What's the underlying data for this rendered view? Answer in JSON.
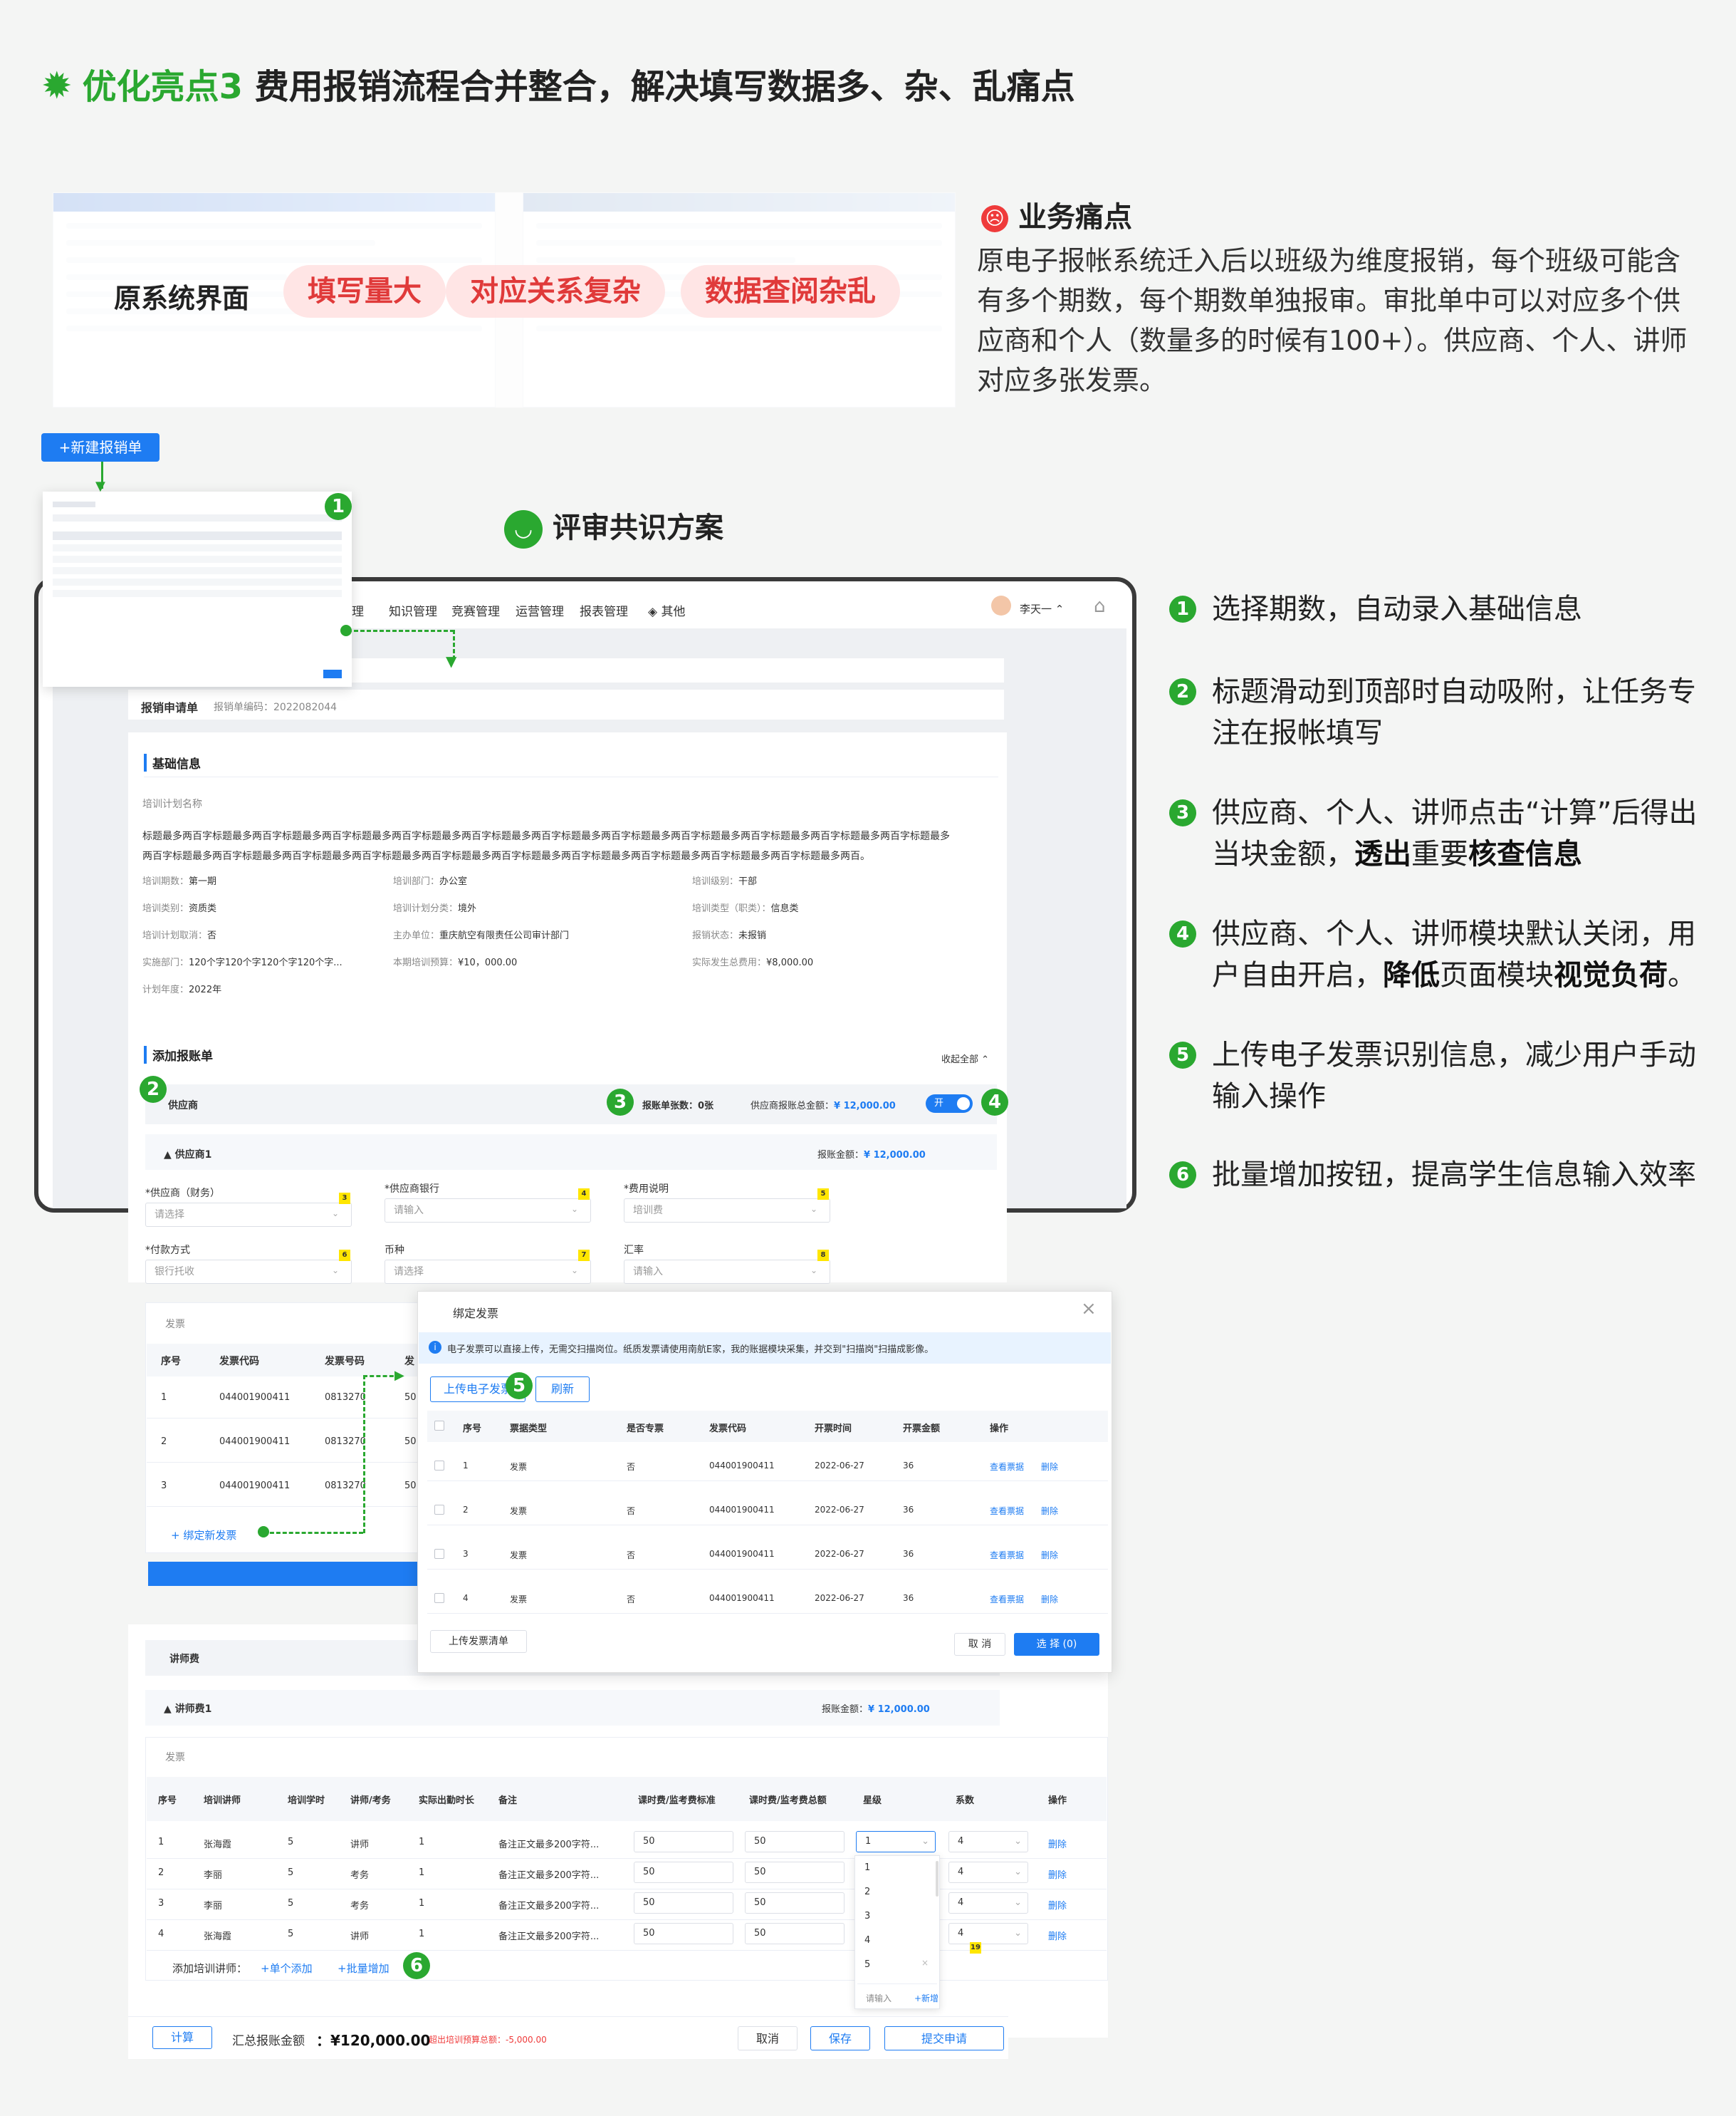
{
  "header": {
    "title_accent": "优化亮点3",
    "title_rest": " 费用报销流程合并整合，解决填写数据多、杂、乱痛点",
    "icon": "gear-badge-icon",
    "accent_color": "#2aa830"
  },
  "original_system": {
    "label": "原系统界面",
    "pills": [
      "填写量大",
      "对应关系复杂",
      "数据查阅杂乱"
    ]
  },
  "pain_point": {
    "title": "业务痛点",
    "body": "原电子报帐系统迁入后以班级为维度报销，每个班级可能含有多个期数，每个期数单独报审。审批单中可以对应多个供应商和个人（数量多的时候有100+）。供应商、个人、讲师对应多张发票。"
  },
  "new_button": "+新建报销单",
  "consensus_title": "评审共识方案",
  "nav": {
    "items": [
      "理",
      "知识管理",
      "竞赛管理",
      "运营管理",
      "报表管理",
      "其他"
    ],
    "user": "李天一"
  },
  "form": {
    "title": "报销申请单",
    "code_label": "报销单编码：",
    "code": "2022082044",
    "basic_section": "基础信息",
    "plan_name_label": "培训计划名称",
    "plan_name": "标题最多两百字标题最多两百字标题最多两百字标题最多两百字标题最多两百字标题最多两百字标题最多两百字标题最多两百字标题最多两百字标题最多两百字标题最多两百字标题最多两百字标题最多两百字标题最多两百字标题最多两百字标题最多两百字标题最多两百字标题最多两百字标题最多两百字标题最多两百字标题最多两百字标题最多两百。",
    "fields": [
      {
        "label": "培训期数：",
        "value": "第一期"
      },
      {
        "label": "培训部门：",
        "value": "办公室"
      },
      {
        "label": "培训级别：",
        "value": "干部"
      },
      {
        "label": "培训类别：",
        "value": "资质类"
      },
      {
        "label": "培训计划分类：",
        "value": "境外"
      },
      {
        "label": "培训类型（职类）：",
        "value": "信息类"
      },
      {
        "label": "培训计划取消：",
        "value": "否"
      },
      {
        "label": "主办单位：",
        "value": "重庆航空有限责任公司审计部门"
      },
      {
        "label": "报销状态：",
        "value": "未报销"
      },
      {
        "label": "实施部门：",
        "value": "120个字120个字120个字120个字..."
      },
      {
        "label": "本期培训预算：",
        "value": "¥10，000.00"
      },
      {
        "label": "实际发生总费用：",
        "value": "¥8,000.00"
      },
      {
        "label": "计划年度：",
        "value": "2022年"
      }
    ],
    "add_section": "添加报账单",
    "collapse": "收起全部",
    "supplier": {
      "title": "供应商",
      "count_label": "报账单张数：",
      "count": "0张",
      "total_label": "供应商报账总金额：",
      "total": "¥ 12,000.00",
      "toggle": "开"
    },
    "supplier1": {
      "title": "供应商1",
      "amount_label": "报账金额：",
      "amount": "¥ 12,000.00"
    },
    "inputs": [
      {
        "label": "*供应商（财务）",
        "value": "请选择",
        "badge": "3"
      },
      {
        "label": "*供应商银行",
        "value": "请输入",
        "badge": "4"
      },
      {
        "label": "*费用说明",
        "value": "培训费",
        "badge": "5"
      },
      {
        "label": "*付款方式",
        "value": "银行托收",
        "badge": "6"
      },
      {
        "label": "币种",
        "value": "请选择",
        "badge": "7"
      },
      {
        "label": "汇率",
        "value": "请输入",
        "badge": "8"
      }
    ],
    "invoice": {
      "title": "发票",
      "headers": [
        "序号",
        "发票代码",
        "发票号码",
        "发"
      ],
      "rows": [
        [
          "1",
          "044001900411",
          "0813270",
          "50"
        ],
        [
          "2",
          "044001900411",
          "0813270",
          "50"
        ],
        [
          "3",
          "044001900411",
          "0813270",
          "50"
        ]
      ],
      "bind_new": "+ 绑定新发票"
    },
    "lecturer": {
      "title": "讲师费",
      "sub": "讲师费1",
      "amount_label": "报账金额：",
      "amount": "¥ 12,000.00",
      "invoice": "发票",
      "headers": [
        "序号",
        "培训讲师",
        "培训学时",
        "讲师/考务",
        "实际出勤时长",
        "备注",
        "课时费/监考费标准",
        "课时费/监考费总额",
        "星级",
        "系数",
        "操作"
      ],
      "rows": [
        [
          "1",
          "张海霞",
          "5",
          "讲师",
          "1",
          "备注正文最多200字符...",
          "50",
          "50",
          "1",
          "4",
          "删除"
        ],
        [
          "2",
          "李丽",
          "5",
          "考务",
          "1",
          "备注正文最多200字符...",
          "50",
          "50",
          "",
          "4",
          "删除"
        ],
        [
          "3",
          "李丽",
          "5",
          "考务",
          "1",
          "备注正文最多200字符...",
          "50",
          "50",
          "",
          "4",
          "删除"
        ],
        [
          "4",
          "张海霞",
          "5",
          "讲师",
          "1",
          "备注正文最多200字符...",
          "50",
          "50",
          "",
          "4",
          "删除"
        ]
      ],
      "add_label": "添加培训讲师：",
      "add_single": "+单个添加",
      "add_batch": "+批量增加",
      "dropdown": [
        "1",
        "2",
        "3",
        "4",
        "5"
      ],
      "dd_input": "请输入",
      "dd_new": "+新增",
      "badge19": "19"
    },
    "footer": {
      "calc": "计算",
      "total_label": "汇总报账金额",
      "total": "¥120,000.00",
      "warn": "超出培训预算总额：-5,000.00",
      "cancel": "取消",
      "save": "保存",
      "submit": "提交申请"
    }
  },
  "dialog": {
    "title": "绑定发票",
    "tip": "电子发票可以直接上传，无需交扫描岗位。纸质发票请使用南航E家，我的账据模块采集，并交到\"扫描岗\"扫描成影像。",
    "upload": "上传电子发票",
    "refresh": "刷新",
    "headers": [
      "序号",
      "票据类型",
      "是否专票",
      "发票代码",
      "开票时间",
      "开票金额",
      "操作"
    ],
    "rows": [
      [
        "1",
        "发票",
        "否",
        "044001900411",
        "2022-06-27",
        "36"
      ],
      [
        "2",
        "发票",
        "否",
        "044001900411",
        "2022-06-27",
        "36"
      ],
      [
        "3",
        "发票",
        "否",
        "044001900411",
        "2022-06-27",
        "36"
      ],
      [
        "4",
        "发票",
        "否",
        "044001900411",
        "2022-06-27",
        "36"
      ]
    ],
    "view": "查看票据",
    "delete": "删除",
    "upload_list": "上传发票清单",
    "cancel": "取 消",
    "choose": "选 择 (0)"
  },
  "points": [
    {
      "n": "1",
      "text": "选择期数，自动录入基础信息"
    },
    {
      "n": "2",
      "text": "标题滑动到顶部时自动吸附，让任务专注在报帐填写"
    },
    {
      "n": "3",
      "pre": "供应商、个人、讲师点击“计算”后得出当块金额，",
      "b1": "透出",
      "mid": "重要",
      "b2": "核查信息"
    },
    {
      "n": "4",
      "pre": "供应商、个人、讲师模块默认关闭，用户自由开启，",
      "b1": "降低",
      "mid": "页面模块",
      "b2": "视觉负荷",
      "post": "。"
    },
    {
      "n": "5",
      "text": "上传电子发票识别信息，减少用户手动输入操作"
    },
    {
      "n": "6",
      "text": "批量增加按钮，提高学生信息输入效率"
    }
  ],
  "markers": [
    "1",
    "2",
    "3",
    "4",
    "5",
    "6"
  ]
}
